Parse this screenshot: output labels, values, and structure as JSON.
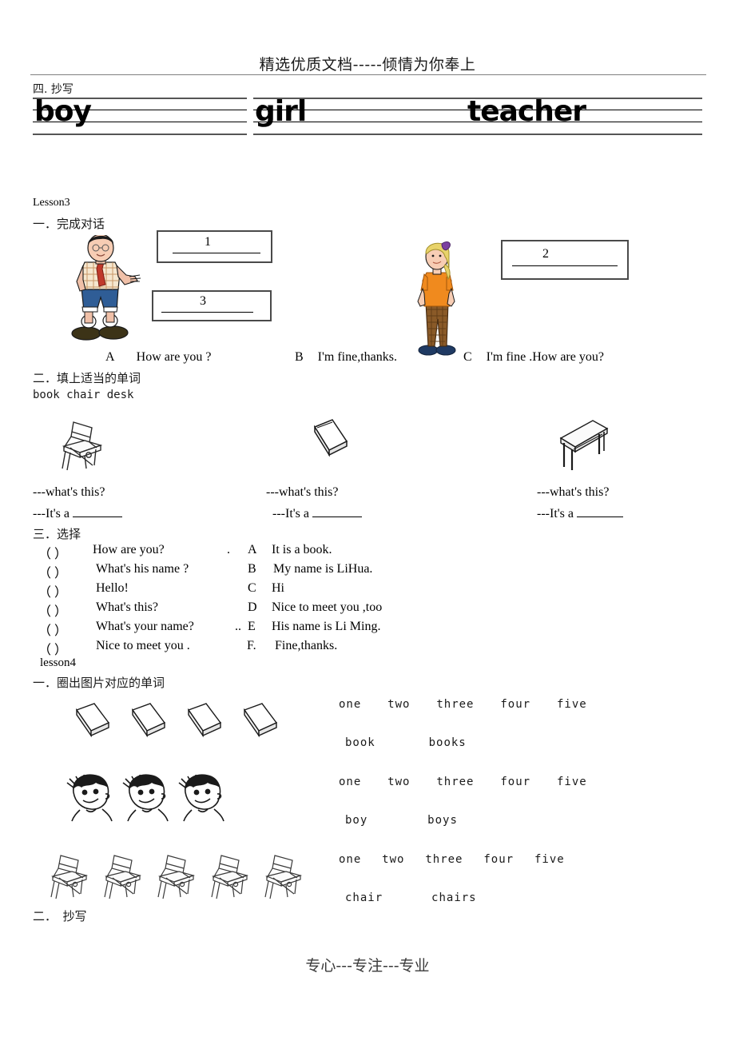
{
  "header": {
    "title": "精选优质文档-----倾情为你奉上"
  },
  "footer": {
    "title": "专心---专注---专业"
  },
  "copywork_top": {
    "heading": "四. 抄写",
    "words": [
      "boy",
      "girl",
      "teacher"
    ]
  },
  "lesson3": {
    "label": "Lesson3",
    "ex1": {
      "heading": "一．完成对话",
      "boxes": [
        {
          "number": "1"
        },
        {
          "number": "2"
        },
        {
          "number": "3"
        }
      ],
      "options": [
        {
          "letter": "A",
          "text": "How are you ?"
        },
        {
          "letter": "B",
          "text": "I'm fine,thanks."
        },
        {
          "letter": "C",
          "text": "I'm fine .How are you?"
        }
      ],
      "figures": [
        "man-figure",
        "girl-figure"
      ]
    },
    "ex2": {
      "heading": "二．填上适当的单词",
      "wordbank": "book  chair  desk",
      "items": [
        {
          "picture": "chair-icon",
          "question": "---what's this?",
          "answer": "---It's a"
        },
        {
          "picture": "book-icon",
          "question": "---what's this?",
          "answer": "---It's a"
        },
        {
          "picture": "desk-icon",
          "question": "---what's this?",
          "answer": "---It's a"
        }
      ]
    },
    "ex3": {
      "heading": "三．选择",
      "left": [
        {
          "bracket": "（    ）",
          "text": "How are you?"
        },
        {
          "bracket": "（    ）",
          "text": "What's his name ?"
        },
        {
          "bracket": "（    ）",
          "text": "Hello!"
        },
        {
          "bracket": "（    ）",
          "text": "What's this?"
        },
        {
          "bracket": "（    ）",
          "text": "What's your name?"
        },
        {
          "bracket": "（    ）",
          "text": "Nice to meet you ."
        }
      ],
      "mid": [
        ".",
        "",
        "",
        "",
        "..",
        ""
      ],
      "right": [
        {
          "letter": "A",
          "text": "It is a book."
        },
        {
          "letter": "B",
          "text": "My name is LiHua."
        },
        {
          "letter": "C",
          "text": "Hi"
        },
        {
          "letter": "D",
          "text": "Nice to meet you ,too"
        },
        {
          "letter": "E",
          "text": "His name is Li Ming."
        },
        {
          "letter": "F.",
          "text": "Fine,thanks."
        }
      ]
    }
  },
  "lesson4": {
    "label": "lesson4",
    "ex1": {
      "heading": "一．圈出图片对应的单词",
      "rows": [
        {
          "picture": "book-icon",
          "count": 4,
          "numbers": [
            "one",
            "two",
            "three",
            "four",
            "five"
          ],
          "words": [
            "book",
            "books"
          ]
        },
        {
          "picture": "boy-face-icon",
          "count": 3,
          "numbers": [
            "one",
            "two",
            "three",
            "four",
            "five"
          ],
          "words": [
            "boy",
            "boys"
          ]
        },
        {
          "picture": "chair-icon",
          "count": 5,
          "numbers": [
            "one",
            "two",
            "three",
            "four",
            "five"
          ],
          "words": [
            "chair",
            "chairs"
          ]
        }
      ]
    },
    "ex2": {
      "heading": "二．　抄写"
    }
  },
  "colors": {
    "rule": "#808080",
    "box_border": "#4a4a4a",
    "text": "#000000"
  }
}
